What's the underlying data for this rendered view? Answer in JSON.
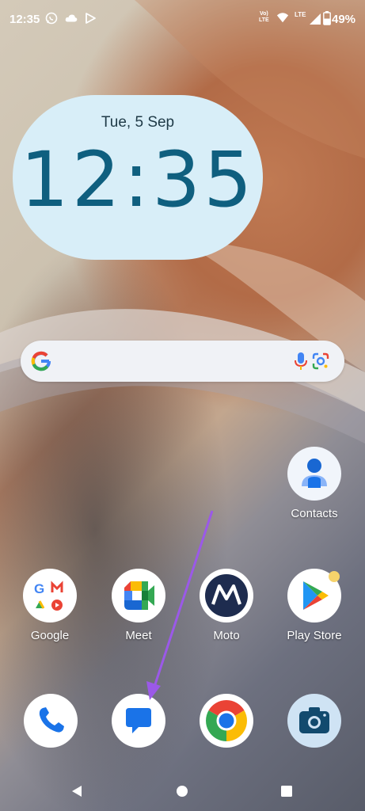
{
  "status_bar": {
    "time": "12:35",
    "network_top": "Vo)",
    "network_bottom": "LTE",
    "lte_label": "LTE",
    "battery_percent": "49%",
    "icons": [
      "whatsapp-icon",
      "cloud-icon",
      "play-games-icon",
      "wifi-icon",
      "signal-icon",
      "battery-icon"
    ]
  },
  "clock_widget": {
    "date": "Tue, 5 Sep",
    "time": "12:35"
  },
  "search_bar": {
    "icons": [
      "google-g-icon",
      "microphone-icon",
      "google-lens-icon"
    ]
  },
  "apps": {
    "contacts": "Contacts",
    "google": "Google",
    "meet": "Meet",
    "moto": "Moto",
    "play_store": "Play Store"
  },
  "dock": {
    "icons": [
      "phone-icon",
      "messages-icon",
      "chrome-icon",
      "camera-icon"
    ]
  },
  "navigation": {
    "icons": [
      "back-icon",
      "home-icon",
      "recents-icon"
    ]
  },
  "colors": {
    "clock_background": "#d8eef8",
    "clock_text": "#0f5f7f",
    "annotation_arrow": "#9b59e8",
    "messages_blue": "#1a73e8"
  }
}
